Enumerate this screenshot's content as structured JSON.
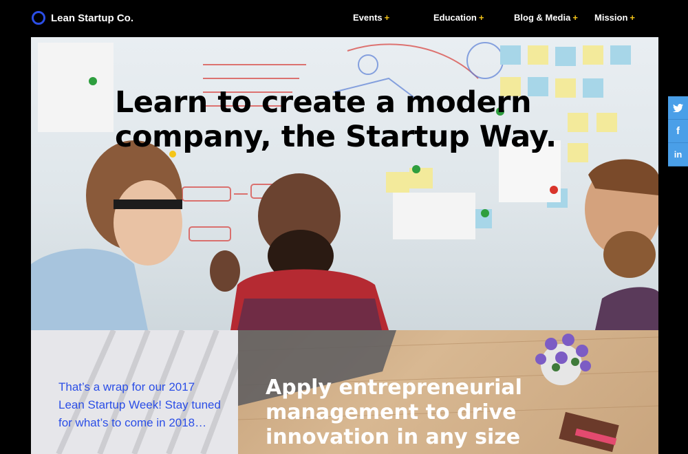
{
  "brand": {
    "name": "Lean Startup Co."
  },
  "nav": {
    "items": [
      {
        "label": "Events",
        "plus": "+"
      },
      {
        "label": "Education",
        "plus": "+"
      },
      {
        "label": "Blog & Media",
        "plus": "+"
      },
      {
        "label": "Mission",
        "plus": "+"
      }
    ]
  },
  "hero": {
    "headline_line1": "Learn to create a modern",
    "headline_line2": "company, the Startup Way."
  },
  "social": {
    "twitter": "twitter-icon",
    "facebook": "facebook-icon",
    "linkedin": "linkedin-icon"
  },
  "promo": {
    "text": "That’s a wrap for our 2017 Lean Startup Week! Stay tuned for what’s to come in 2018…"
  },
  "feature": {
    "text": "Apply entrepreneurial management to drive innovation in any size"
  },
  "colors": {
    "brand_blue": "#2b4ee6",
    "nav_plus": "#f5c518",
    "social_blue": "#4a9fe8"
  }
}
